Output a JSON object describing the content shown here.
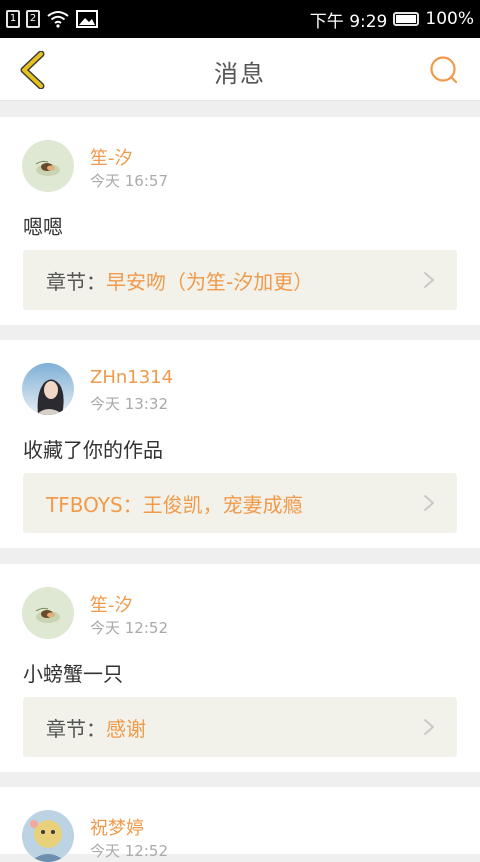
{
  "status_bar": {
    "sim1": "1",
    "sim2": "2",
    "time": "下午 9:29",
    "battery": "100%"
  },
  "header": {
    "title": "消息"
  },
  "messages": [
    {
      "username": "笙-汐",
      "time": "今天 16:57",
      "content": "嗯嗯",
      "ref_prefix": "章节：",
      "ref_text": "早安吻（为笙-汐加更）"
    },
    {
      "username": "ZHn1314",
      "time": "今天 13:32",
      "content": "收藏了你的作品",
      "ref_prefix": "",
      "ref_text": "TFBOYS：王俊凯，宠妻成瘾"
    },
    {
      "username": "笙-汐",
      "time": "今天 12:52",
      "content": "小螃蟹一只",
      "ref_prefix": "章节：",
      "ref_text": "感谢"
    },
    {
      "username": "祝梦婷",
      "time": "今天 12:52"
    }
  ],
  "colors": {
    "accent": "#f09a4b",
    "back_arrow": "#e6c21f",
    "ref_bg": "#f3f2ea",
    "page_bg": "#efefef"
  }
}
